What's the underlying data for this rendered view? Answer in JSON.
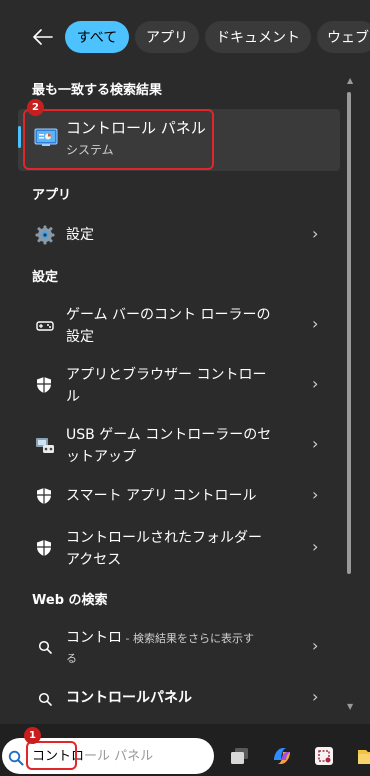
{
  "filter_tabs": [
    {
      "label": "すべて",
      "active": true
    },
    {
      "label": "アプリ",
      "active": false
    },
    {
      "label": "ドキュメント",
      "active": false
    },
    {
      "label": "ウェブ",
      "active": false
    }
  ],
  "best_match": {
    "section": "最も一致する検索結果",
    "title": "コントロール パネル",
    "subtitle": "システム",
    "badge": "2"
  },
  "apps": {
    "section": "アプリ",
    "items": [
      {
        "title": "設定",
        "icon": "settings-gear-icon"
      }
    ]
  },
  "settings": {
    "section": "設定",
    "items": [
      {
        "line1": "ゲーム バーのコント ローラーの",
        "line2": "設定",
        "icon": "game-controller-icon"
      },
      {
        "line1": "アプリとブラウザー コントロー",
        "line2": "ル",
        "icon": "shield-icon"
      },
      {
        "line1": "USB ゲーム コントローラーのセ",
        "line2": "ットアップ",
        "icon": "usb-device-icon"
      },
      {
        "line1": "スマート アプリ コントロール",
        "line2": "",
        "icon": "shield-icon"
      },
      {
        "line1": "コントロールされたフォルダー",
        "line2": "アクセス",
        "icon": "shield-icon"
      }
    ]
  },
  "web": {
    "section": "Web の検索",
    "items": [
      {
        "query": "コントロ",
        "suffix": " - 検索結果をさらに表示す",
        "line2": "る",
        "icon": "search-icon"
      },
      {
        "query": "コントロールパネル",
        "suffix": "",
        "line2": "",
        "icon": "search-icon"
      }
    ]
  },
  "taskbar": {
    "search_value": "コントロ",
    "search_autocomplete": "ール パネル",
    "badge": "1"
  },
  "colors": {
    "accent": "#4cc2ff",
    "highlight": "#e0262b",
    "panel": "#2b2b2b",
    "row_selected": "#3a3a3a"
  }
}
